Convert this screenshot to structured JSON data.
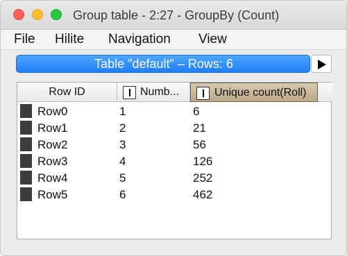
{
  "window": {
    "title": "Group table - 2:27 - GroupBy (Count)"
  },
  "menu": [
    {
      "label": "File"
    },
    {
      "label": "Hilite"
    },
    {
      "label": "Navigation"
    },
    {
      "label": "View"
    }
  ],
  "table_bar": {
    "label": "Table \"default\" – Rows: 6",
    "accent_color": "#1f7ff6"
  },
  "table": {
    "columns": [
      {
        "label": "Row ID"
      },
      {
        "label": "Numb...",
        "icon": "integer-type-icon"
      },
      {
        "label": "Unique count(Roll)",
        "icon": "integer-type-icon",
        "selected": true
      }
    ],
    "rows": [
      {
        "id": "Row0",
        "number": "1",
        "unique": "6"
      },
      {
        "id": "Row1",
        "number": "2",
        "unique": "21"
      },
      {
        "id": "Row2",
        "number": "3",
        "unique": "56"
      },
      {
        "id": "Row3",
        "number": "4",
        "unique": "126"
      },
      {
        "id": "Row4",
        "number": "5",
        "unique": "252"
      },
      {
        "id": "Row5",
        "number": "6",
        "unique": "462"
      }
    ]
  }
}
